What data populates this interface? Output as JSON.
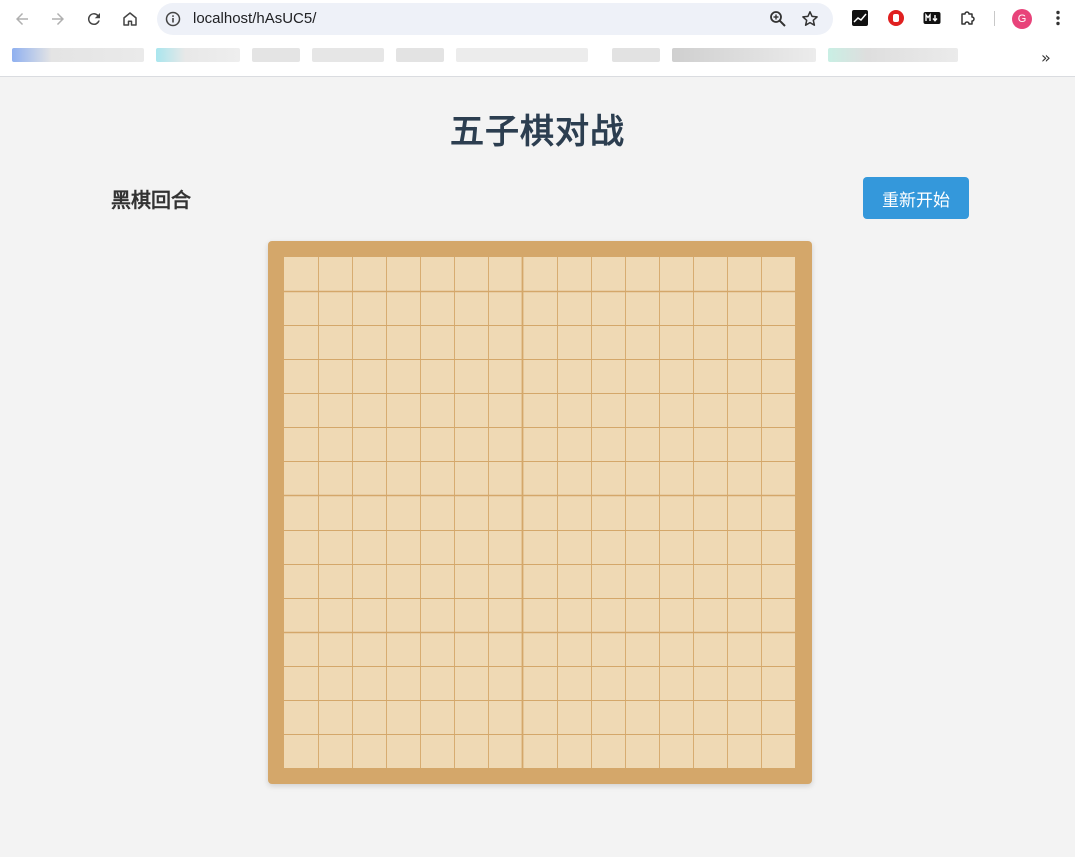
{
  "browser": {
    "url": "localhost/hAsUC5/",
    "profile_initial": "G"
  },
  "page": {
    "title": "五子棋对战",
    "status": "黑棋回合",
    "restart_label": "重新开始"
  },
  "board": {
    "size": 15,
    "stones": []
  },
  "colors": {
    "title": "#2c3e50",
    "button": "#3498db",
    "board_frame": "#d4a76a",
    "board_surface": "#efd9b4",
    "grid_line": "#d4a76a"
  }
}
